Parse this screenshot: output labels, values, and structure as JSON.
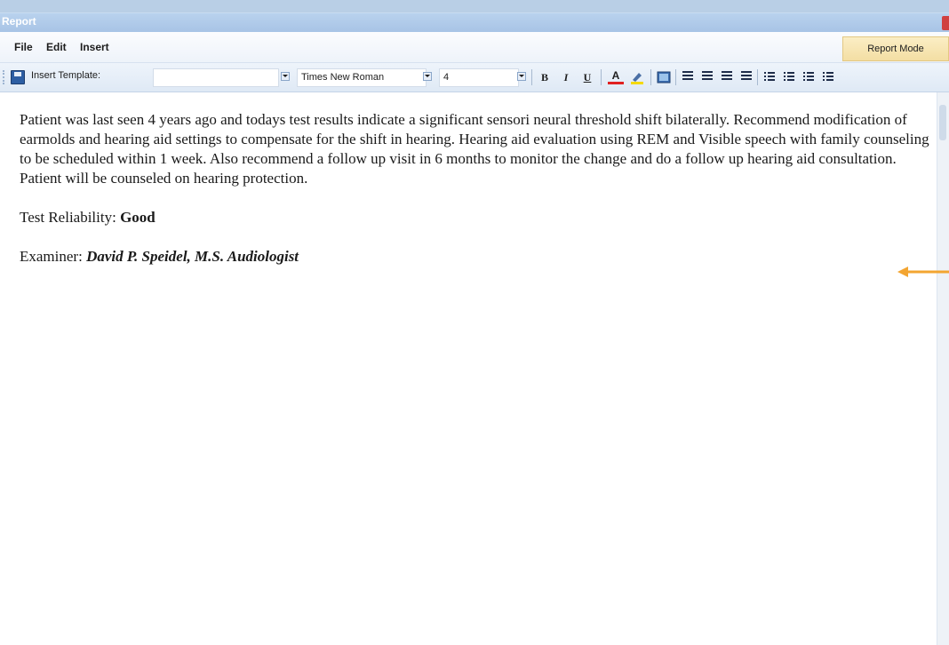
{
  "window": {
    "title": "Report"
  },
  "menu": {
    "items": [
      "File",
      "Edit",
      "Insert"
    ],
    "mode_button": "Report Mode"
  },
  "toolbar": {
    "insert_template_label": "Insert Template:",
    "template_value": "",
    "font_name": "Times New Roman",
    "font_size": "4",
    "buttons": {
      "bold": "B",
      "italic": "I",
      "underline": "U",
      "font_color": "A"
    }
  },
  "document": {
    "paragraph": "Patient was last seen 4 years ago and  todays test results indicate a significant sensori neural threshold shift bilaterally.  Recommend modification of earmolds and hearing aid settings to compensate for the shift in hearing.  Hearing aid evaluation using REM and Visible speech with family counseling to be scheduled within 1 week. Also recommend a follow up visit in 6 months to monitor the change and do a follow up hearing aid consultation.  Patient will be counseled on hearing protection.",
    "reliability_label": "Test Reliability:",
    "reliability_value": "Good",
    "examiner_label": "Examiner:",
    "examiner_value": "David P. Speidel, M.S. Audiologist"
  },
  "annotation": {
    "arrow_color": "#f3a531"
  }
}
